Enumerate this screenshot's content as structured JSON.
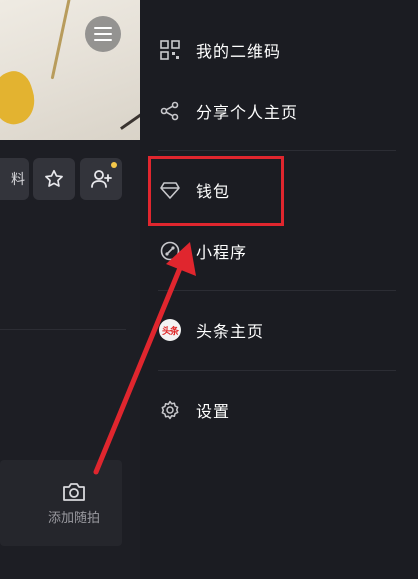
{
  "profile": {
    "partial_button_label": "料",
    "add_photo_label": "添加随拍"
  },
  "drawer": {
    "items": [
      {
        "label": "我的二维码",
        "icon": "qr-code-icon"
      },
      {
        "label": "分享个人主页",
        "icon": "share-icon"
      },
      {
        "label": "钱包",
        "icon": "diamond-icon"
      },
      {
        "label": "小程序",
        "icon": "mini-program-icon"
      },
      {
        "label": "头条主页",
        "icon": "toutiao-logo-icon",
        "badge_text": "头条"
      },
      {
        "label": "设置",
        "icon": "gear-icon"
      }
    ]
  },
  "annotation": {
    "color": "#e0262e",
    "target": "钱包"
  },
  "colors": {
    "background": "#1b1c22",
    "button": "#33343b",
    "dot": "#f5c84a"
  }
}
